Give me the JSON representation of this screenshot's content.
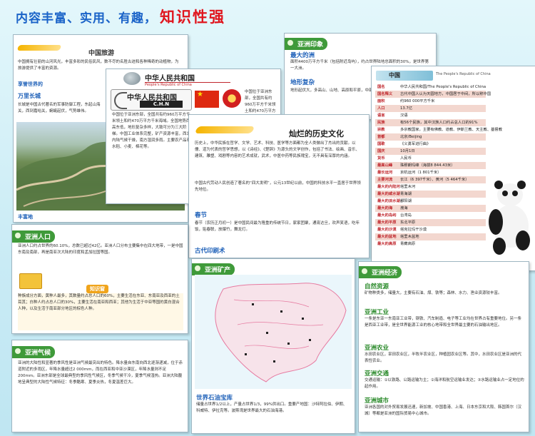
{
  "headline": {
    "part1": "内容丰富、实用、有趣，",
    "part2": "知识性强"
  },
  "tour": {
    "title": "中国旅游",
    "body": "中国拥有壮丽的山河风光，丰富多彩的民俗民风，数不尽的名胜古迹和各种稀奇的动植物，为旅游提供了丰富的资源。",
    "sub1": "享誉世界的",
    "sub2": "万里长城",
    "sub2_body": "长城是中国古代著名的军事防御工程，东起山海关，西到嘉峪关，蜿蜒起伏，气势雄伟。",
    "sub3": "丰富地"
  },
  "prc": {
    "cn_name": "中华人民共和国",
    "en_name": "People's Republic of China",
    "big_title": "中华人民共和国",
    "abbr": "C.H.N",
    "body": "中国位于亚洲东部，全国共有约960万平方千米领土和约470万平方千米海域。全国地势西高东低，地形复杂多样，大致可分为三大阶梯。中国工业体系完整，矿产资源丰富，西北内陆气候干燥，南方湿润多雨。主要农产品有水稻、小麦、棉花等。"
  },
  "asia_impress": {
    "title": "亚洲印象",
    "h1": "最大的洲",
    "b1": "面积4400万平方千米（包括附近岛屿），约占世界陆地总面积的30%，是世界第一大洲。",
    "h2": "地形复杂",
    "b2": "地形起伏大，多高山、山地、高原和平原，中部高四周低，地形复杂多样。"
  },
  "china_panel": {
    "title": "中国",
    "en_name": "The People's Republic of China",
    "rows": [
      {
        "k": "国名",
        "v": "中华人民共和国/The People's Republic of China"
      },
      {
        "k": "国名释义",
        "v": "古代中国人认为天圆地方，中国居于中间，所以称中国"
      },
      {
        "k": "面积",
        "v": "约960 000平方千米"
      },
      {
        "k": "人口",
        "v": "13.7亿"
      },
      {
        "k": "语言",
        "v": "汉语"
      },
      {
        "k": "民族",
        "v": "有56个民族，其中汉族人口约占总人口的91%"
      },
      {
        "k": "宗教",
        "v": "多宗教国家，主要有佛教、道教、伊斯兰教、天主教、基督教"
      },
      {
        "k": "首都",
        "v": "北京/Beijing"
      },
      {
        "k": "国歌",
        "v": "《义勇军进行曲》"
      },
      {
        "k": "国庆",
        "v": "10月1日"
      },
      {
        "k": "货币",
        "v": "人民币"
      },
      {
        "k": "最高山峰",
        "v": "珠穆朗玛峰（海拔8 844.43米）"
      },
      {
        "k": "最长运河",
        "v": "京杭运河（1 801千米）"
      },
      {
        "k": "主要河流",
        "v": "长江（6 397千米）、黄河（5 464千米）"
      },
      {
        "k": "最大的内陆河",
        "v": "塔里木河"
      },
      {
        "k": "最大的咸水湖",
        "v": "青海湖"
      },
      {
        "k": "最大的淡水湖",
        "v": "鄱阳湖"
      },
      {
        "k": "最大的海",
        "v": "渤海"
      },
      {
        "k": "最大的岛屿",
        "v": "台湾岛"
      },
      {
        "k": "最大的平原",
        "v": "东北平原"
      },
      {
        "k": "最大的沙漠",
        "v": "塔克拉玛干沙漠"
      },
      {
        "k": "最大的盆地",
        "v": "塔里木盆地"
      },
      {
        "k": "最大的高原",
        "v": "青藏高原"
      }
    ]
  },
  "culture": {
    "title": "灿烂的历史文化",
    "body": "历史上，中华民族在哲学、文学、艺术、科技、医学等方面都为全人类做出了杰出的贡献。以儒、道为代表的哲学思想，以《诗经》、《楚辞》为源头的文学创作，包括了书法、绘画、音乐、建筑、雕塑、戏剧等内容的艺术成就，武术，中医中药等民族瑰宝，无不具有深厚的内涵。",
    "body2": "中国古代劳动人民创造了著名的“四大发明”，公元13世纪以前，中国的科技水平一直居于世界领先地位。",
    "h1": "春节",
    "b1": "春节（农历正月初一）是中国民间最为隆重的传统节日，家家团聚，通宵达旦，欢声笑语，吃年饭，贴春联，放爆竹，舞龙灯。",
    "h2": "古代印刷术"
  },
  "population": {
    "title": "亚洲人口",
    "body": "亚洲人口约占世界的60.10%，总数已超过42亿。亚洲人口分布主要集中在四大地带，一是中国东南及南部，再是南亚次大陆的印度和孟加拉国等国。",
    "tip_title": "知识窗",
    "tip_body": "种族成分方面，黄种人最多，其数量约占总人口的60%，主要生活在东亚、东南亚及西亚的土耳其；白种人约占总人口的30%，主要生活在南亚和西亚；其他为生活于中亚等国的黄白混合人种，以及生活于南亚部分地区的棕色人种。"
  },
  "climate": {
    "title": "亚洲气候",
    "body": "亚洲的大陆性和显著的季风性是亚洲气候最突出的特色。降水量自东南向西北逐渐递减，位于赤道附近的多雨区，年降水量超过2 000mm，而在西亚和中亚沙漠区，年降水量则不足200mm。亚洲东部是全球最典型的季风性气候区，冬季气候干冷，夏季气候湿热。亚洲大陆腹地呈典型的大陆性气候特征：冬季酷寒、夏季炎热，冬夏温差巨大。"
  },
  "minerals": {
    "title": "亚洲矿产",
    "h1": "世界石油宝库",
    "b1": "储量占世界1/2以上，产量占世界1/3，99%供出口。重要产地国：沙特阿拉伯、伊朗、科威特、伊拉克等。波斯湾是世界最大的石油海港。"
  },
  "economy": {
    "title": "亚洲经济",
    "h1": "自然资源",
    "b1": "矿物种类多，储量大，主要有石油、煤、铁等；森林、水力、渔业资源较丰富。",
    "h2": "亚洲工业",
    "b2": "一条是东亚一东南亚工业带，钢铁、汽车制造、电子等工业均在世界占有重要地位。另一条是西亚工业带，是全世界能源工业的核心地带和全世界最主要的石油输出地区。",
    "h3": "亚洲农业",
    "b3": "水田农业区，旱田农业区，半牧半农业区，种植园农业区等。其中，水田农业区是亚洲的代表性农业。",
    "h4": "亚洲交通",
    "b4": "交通运输：①以铁路、公路运输为主；②海洋和航空运输业发达；③水路运输业占一定地位的起作用。",
    "h5": "亚洲城市",
    "b5": "亚洲各国的对外贸易发展迅速，新加坡、中国香港、上海、日本东京和大阪、韩国首尔（汉城）等都是亚洲的国际贸易中心城市。"
  },
  "colors": {
    "accent_red": "#e0161e",
    "title_green": "#3f9a3a",
    "heading_blue": "#1c5fb8"
  },
  "icons": [
    "globe-icon",
    "china-flag-icon",
    "national-emblem-icon",
    "panda-illustration",
    "asia-map-illustration",
    "great-wall-photo"
  ]
}
